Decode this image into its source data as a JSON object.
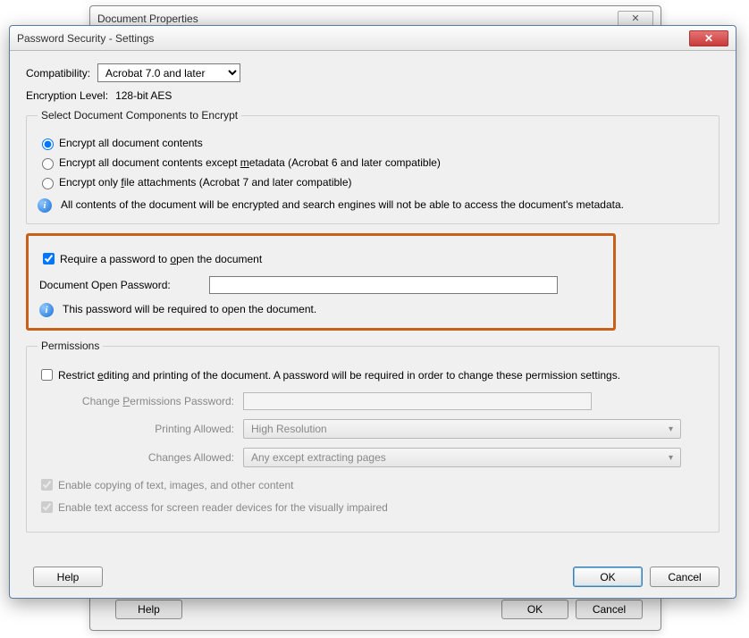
{
  "bg": {
    "title": "Document Properties",
    "close_glyph": "✕",
    "help": "Help",
    "ok": "OK",
    "cancel": "Cancel"
  },
  "dialog": {
    "title": "Password Security - Settings",
    "close_glyph": "✕",
    "compat_label": "Compatibility:",
    "compat_value": "Acrobat 7.0 and later",
    "enc_label": "Encryption  Level:",
    "enc_value": "128-bit AES",
    "group_encrypt_legend": "Select Document Components to Encrypt",
    "radio_all": "Encrypt all document contents",
    "radio_meta_pre": "Encrypt all document contents except ",
    "radio_meta_u": "m",
    "radio_meta_post": "etadata (Acrobat 6 and later compatible)",
    "radio_file_pre": "Encrypt only ",
    "radio_file_u": "f",
    "radio_file_post": "ile attachments (Acrobat 7 and later compatible)",
    "encrypt_info": "All contents of the document will be encrypted and search engines will not be able to access the document's metadata.",
    "require_open_pre": "Require a password to ",
    "require_open_u": "o",
    "require_open_post": "pen the document",
    "open_pw_label": "Document Open Password:",
    "open_pw_info": "This password will be required to open the document.",
    "perm_legend": "Permissions",
    "restrict_pre": "Restrict ",
    "restrict_u": "e",
    "restrict_post": "diting and printing of the document. A password will be required in order to change these permission settings.",
    "change_pw_pre": "Change ",
    "change_pw_u": "P",
    "change_pw_post": "ermissions Password:",
    "printing_label": "Printing Allowed:",
    "printing_value": "High Resolution",
    "changes_label": "Changes Allowed:",
    "changes_value": "Any except extracting pages",
    "enable_copy": "Enable copying of text, images, and other content",
    "enable_screen": "Enable text access for screen reader devices for the visually impaired",
    "help": "Help",
    "ok": "OK",
    "cancel": "Cancel",
    "info_glyph": "i"
  }
}
